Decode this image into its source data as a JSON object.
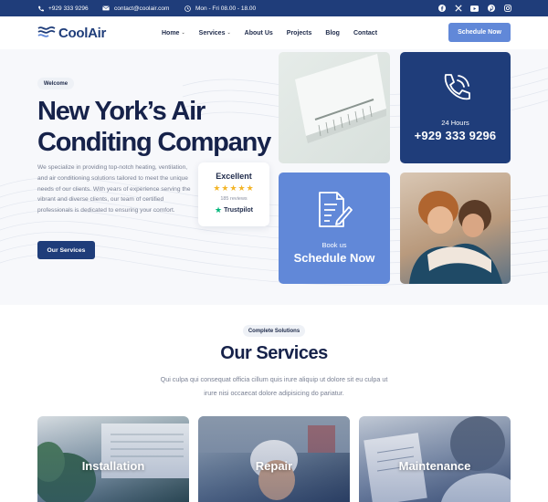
{
  "topbar": {
    "phone": "+929 333 9296",
    "email": "contact@coolair.com",
    "hours": "Mon - Fri 08.00 - 18.00",
    "social_icons": [
      "facebook-icon",
      "x-icon",
      "youtube-icon",
      "pinterest-icon",
      "instagram-icon"
    ]
  },
  "header": {
    "logo": "CoolAir",
    "nav": [
      {
        "label": "Home",
        "dropdown": true
      },
      {
        "label": "Services",
        "dropdown": true
      },
      {
        "label": "About Us",
        "dropdown": false
      },
      {
        "label": "Projects",
        "dropdown": false
      },
      {
        "label": "Blog",
        "dropdown": false
      },
      {
        "label": "Contact",
        "dropdown": false
      }
    ],
    "cta": "Schedule Now"
  },
  "hero": {
    "badge": "Welcome",
    "title_line1": "New York’s Air",
    "title_line2": "Conditing Company",
    "text": "We specialize in providing top-notch heating, ventilation, and air conditioning solutions tailored to meet the unique needs of our clients. With years of experience serving the vibrant and diverse clients, our team of certified professionals is dedicated to ensuring your comfort.",
    "button": "Our Services"
  },
  "review": {
    "title": "Excellent",
    "stars": "★★★★★",
    "count": "185 reviews",
    "brand": "Trustpilot",
    "star_color": "#f3b529"
  },
  "tiles": {
    "phone": {
      "small": "24 Hours",
      "big": "+929 333 9296"
    },
    "book": {
      "small": "Book us",
      "big": "Schedule Now"
    }
  },
  "services": {
    "badge": "Complete Solutions",
    "title": "Our Services",
    "text": "Qui culpa qui consequat officia cillum quis irure aliquip ut dolore sit eu culpa ut irure nisi occaecat dolore adipisicing do pariatur.",
    "cards": [
      {
        "label": "Installation"
      },
      {
        "label": "Repair"
      },
      {
        "label": "Maintenance"
      }
    ]
  },
  "colors": {
    "primary": "#1f3d7a",
    "accent": "#6188d8",
    "text": "#16224a"
  }
}
